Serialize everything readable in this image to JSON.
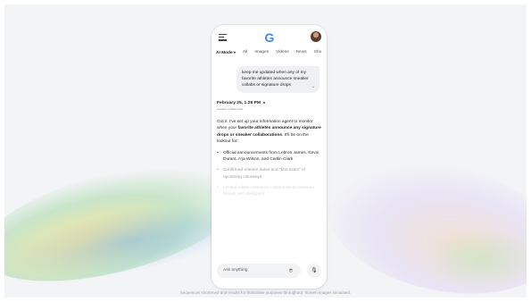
{
  "header": {
    "logo_text": "G",
    "brand_color": "#4285f4"
  },
  "tabs": [
    {
      "label": "AI Mode",
      "active": true
    },
    {
      "label": "All"
    },
    {
      "label": "Images"
    },
    {
      "label": "Videos"
    },
    {
      "label": "News"
    },
    {
      "label": "Sho"
    }
  ],
  "query": {
    "text": "keep me updated when any of my favorite athletes announce sneaker collabs or signature drops"
  },
  "response": {
    "date": "February 25, 1:29 PM",
    "sub_label": "Sneaker Collabs Task",
    "intro_start": "Got it. I've set up your information agent to monitor when your ",
    "intro_bold": "favorite athletes announce any signature drops or sneaker collaborations",
    "intro_end": ". It'll be on the lookout for:",
    "bullets": [
      "Official announcements from Lebron James, Kevin Durant, A'ja Wilson, and Caitlin Clark",
      "Confirmed release dates and \"first looks\" of upcoming colorways",
      "Limited edition releases, collaborations between brands and designers"
    ]
  },
  "ask": {
    "placeholder": "Ask anything",
    "lens_icon": "lens-icon",
    "mic_icon": "mic-icon"
  },
  "caption": "Sequences shortened and results for illustrative purposes throughout. Screen images simulated."
}
